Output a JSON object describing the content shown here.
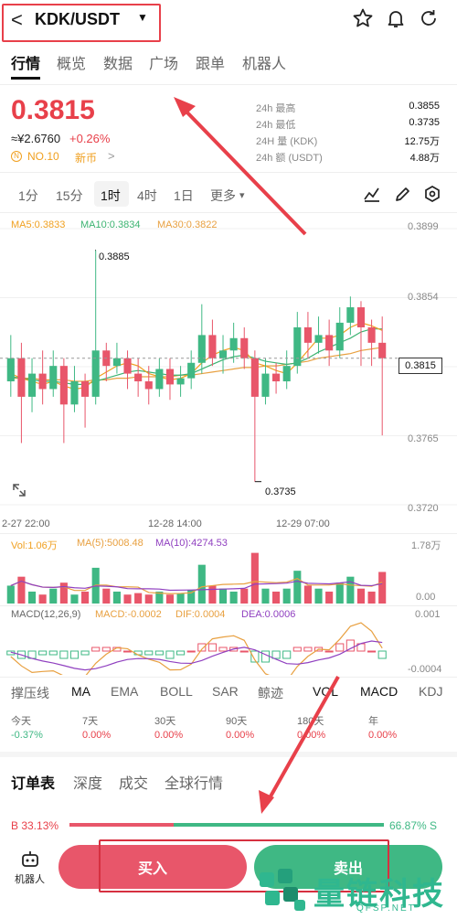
{
  "header": {
    "back": "<",
    "pair": "KDK/USDT",
    "caret": "▼"
  },
  "tabs": [
    "行情",
    "概览",
    "数据",
    "广场",
    "跟单",
    "机器人"
  ],
  "price": {
    "last": "0.3815",
    "cny": "≈¥2.6760",
    "change": "+0.26%",
    "rank": "NO.10",
    "tag": "新币",
    "tag_arrow": ">"
  },
  "stats": [
    {
      "label": "24h  最高",
      "value": "0.3855"
    },
    {
      "label": "24h  最低",
      "value": "0.3735"
    },
    {
      "label": "24H  量 (KDK)",
      "value": "12.75万"
    },
    {
      "label": "24h  额 (USDT)",
      "value": "4.88万"
    }
  ],
  "intervals": [
    "1分",
    "15分",
    "1时",
    "4时",
    "1日",
    "更多"
  ],
  "more_caret": "▾",
  "ma_legend": {
    "ma5": "MA5:0.3833",
    "ma10": "MA10:0.3834",
    "ma30": "MA30:0.3822"
  },
  "yaxis": [
    "0.3899",
    "0.3854",
    "0.3815",
    "0.3765",
    "0.3720"
  ],
  "xaxis": [
    "2-27 22:00",
    "12-28 14:00",
    "12-29 07:00"
  ],
  "annotations": {
    "high": "0.3885",
    "low": "0.3735"
  },
  "vol_legend": {
    "vol": "Vol:1.06万",
    "ma5": "MA(5):5008.48",
    "ma10": "MA(10):4274.53"
  },
  "vol_axis": [
    "1.78万",
    "0.00"
  ],
  "macd_legend": {
    "label": "MACD(12,26,9)",
    "macd": "MACD:-0.0002",
    "dif": "DIF:0.0004",
    "dea": "DEA:0.0006"
  },
  "macd_axis": [
    "0.001",
    "-0.0004"
  ],
  "indicators": [
    "撑压线",
    "MA",
    "EMA",
    "BOLL",
    "SAR",
    "鲸迹",
    "VOL",
    "MACD",
    "KDJ"
  ],
  "performance": [
    {
      "label": "今天",
      "value": "-0.37%"
    },
    {
      "label": "7天",
      "value": "0.00%"
    },
    {
      "label": "30天",
      "value": "0.00%"
    },
    {
      "label": "90天",
      "value": "0.00%"
    },
    {
      "label": "180天",
      "value": "0.00%"
    },
    {
      "label": "年",
      "value": "0.00%"
    }
  ],
  "book_tabs": [
    "订单表",
    "深度",
    "成交",
    "全球行情"
  ],
  "book_ratio": {
    "buy": "B 33.13%",
    "sell": "66.87% S",
    "buy_fraction": 0.3313
  },
  "bottom": {
    "robot": "机器人",
    "buy": "买入",
    "sell": "卖出"
  },
  "watermark": {
    "brand": "量链科技",
    "site": "QFSP.NET"
  },
  "chart_data": {
    "type": "candlestick",
    "yrange": [
      0.372,
      0.3899
    ],
    "candles": [
      [
        0.38,
        0.3815,
        0.383,
        0.379
      ],
      [
        0.3815,
        0.379,
        0.3825,
        0.376
      ],
      [
        0.379,
        0.3805,
        0.3815,
        0.378
      ],
      [
        0.3805,
        0.3795,
        0.382,
        0.3785
      ],
      [
        0.3795,
        0.381,
        0.382,
        0.379
      ],
      [
        0.381,
        0.3785,
        0.3815,
        0.376
      ],
      [
        0.3785,
        0.38,
        0.381,
        0.378
      ],
      [
        0.38,
        0.379,
        0.3805,
        0.377
      ],
      [
        0.379,
        0.382,
        0.3885,
        0.3785
      ],
      [
        0.382,
        0.381,
        0.3825,
        0.38
      ],
      [
        0.381,
        0.3815,
        0.3825,
        0.3805
      ],
      [
        0.3815,
        0.3805,
        0.382,
        0.3795
      ],
      [
        0.3805,
        0.38,
        0.3815,
        0.379
      ],
      [
        0.38,
        0.3795,
        0.381,
        0.3785
      ],
      [
        0.3795,
        0.3808,
        0.3815,
        0.379
      ],
      [
        0.3808,
        0.3798,
        0.3815,
        0.3788
      ],
      [
        0.3798,
        0.3802,
        0.381,
        0.379
      ],
      [
        0.3802,
        0.3812,
        0.382,
        0.3795
      ],
      [
        0.3812,
        0.383,
        0.385,
        0.3805
      ],
      [
        0.383,
        0.3815,
        0.384,
        0.381
      ],
      [
        0.3815,
        0.382,
        0.383,
        0.3805
      ],
      [
        0.382,
        0.3828,
        0.3838,
        0.3812
      ],
      [
        0.3828,
        0.3815,
        0.3835,
        0.3808
      ],
      [
        0.3815,
        0.379,
        0.382,
        0.3735
      ],
      [
        0.379,
        0.3805,
        0.3815,
        0.3785
      ],
      [
        0.3805,
        0.38,
        0.3812,
        0.3792
      ],
      [
        0.38,
        0.381,
        0.382,
        0.3795
      ],
      [
        0.381,
        0.3835,
        0.3845,
        0.3805
      ],
      [
        0.3835,
        0.3825,
        0.3845,
        0.3815
      ],
      [
        0.3825,
        0.383,
        0.3842,
        0.3818
      ],
      [
        0.383,
        0.382,
        0.384,
        0.381
      ],
      [
        0.382,
        0.3838,
        0.3848,
        0.3815
      ],
      [
        0.3838,
        0.3848,
        0.3855,
        0.383
      ],
      [
        0.3848,
        0.3835,
        0.3852,
        0.381
      ],
      [
        0.3835,
        0.3825,
        0.384,
        0.381
      ],
      [
        0.3825,
        0.3815,
        0.3842,
        0.3765
      ]
    ],
    "ma5": [
      0.3805,
      0.3802,
      0.38,
      0.3798,
      0.38,
      0.3797,
      0.3795,
      0.3796,
      0.3802,
      0.3806,
      0.381,
      0.3812,
      0.381,
      0.3805,
      0.3803,
      0.3801,
      0.3802,
      0.3805,
      0.3812,
      0.3817,
      0.382,
      0.3822,
      0.382,
      0.3812,
      0.381,
      0.3807,
      0.3805,
      0.3812,
      0.382,
      0.3828,
      0.3828,
      0.383,
      0.3835,
      0.3838,
      0.3836,
      0.3833
    ],
    "ma10": [
      0.3803,
      0.3802,
      0.3801,
      0.38,
      0.38,
      0.3799,
      0.3798,
      0.3798,
      0.38,
      0.3802,
      0.3804,
      0.3806,
      0.3807,
      0.3806,
      0.3805,
      0.3804,
      0.3804,
      0.3805,
      0.3808,
      0.3811,
      0.3814,
      0.3816,
      0.3817,
      0.3815,
      0.3813,
      0.3812,
      0.3811,
      0.3812,
      0.3815,
      0.3819,
      0.3822,
      0.3825,
      0.3828,
      0.3832,
      0.3834,
      0.3834
    ],
    "ma30": [
      0.3802,
      0.3802,
      0.3802,
      0.3801,
      0.3801,
      0.3801,
      0.38,
      0.38,
      0.3801,
      0.3801,
      0.3802,
      0.3802,
      0.3803,
      0.3803,
      0.3803,
      0.3803,
      0.3804,
      0.3804,
      0.3805,
      0.3806,
      0.3807,
      0.3808,
      0.3809,
      0.3809,
      0.381,
      0.381,
      0.3811,
      0.3812,
      0.3813,
      0.3815,
      0.3816,
      0.3817,
      0.3818,
      0.382,
      0.3821,
      0.3822
    ],
    "volume": [
      0.6,
      0.9,
      0.4,
      0.3,
      0.5,
      0.7,
      0.3,
      0.4,
      1.2,
      0.5,
      0.4,
      0.3,
      0.35,
      0.3,
      0.4,
      0.3,
      0.35,
      0.45,
      1.3,
      0.6,
      0.5,
      0.4,
      0.5,
      1.7,
      0.5,
      0.4,
      0.5,
      1.1,
      0.6,
      0.5,
      0.4,
      0.7,
      0.9,
      0.5,
      0.4,
      1.06
    ],
    "macd": [
      -0.0001,
      -0.0002,
      -0.0002,
      -0.0001,
      -0.0001,
      -0.0002,
      -0.0002,
      -0.0001,
      0.0001,
      0.0001,
      0.0001,
      0.0,
      -0.0001,
      -0.0001,
      -0.0001,
      -0.0002,
      -0.0001,
      0.0,
      0.0002,
      0.0002,
      0.0001,
      0.0001,
      0.0,
      -0.0003,
      -0.0003,
      -0.0002,
      -0.0002,
      0.0001,
      0.0001,
      0.0001,
      0.0,
      0.0002,
      0.0003,
      0.0002,
      0.0,
      -0.0002
    ]
  }
}
